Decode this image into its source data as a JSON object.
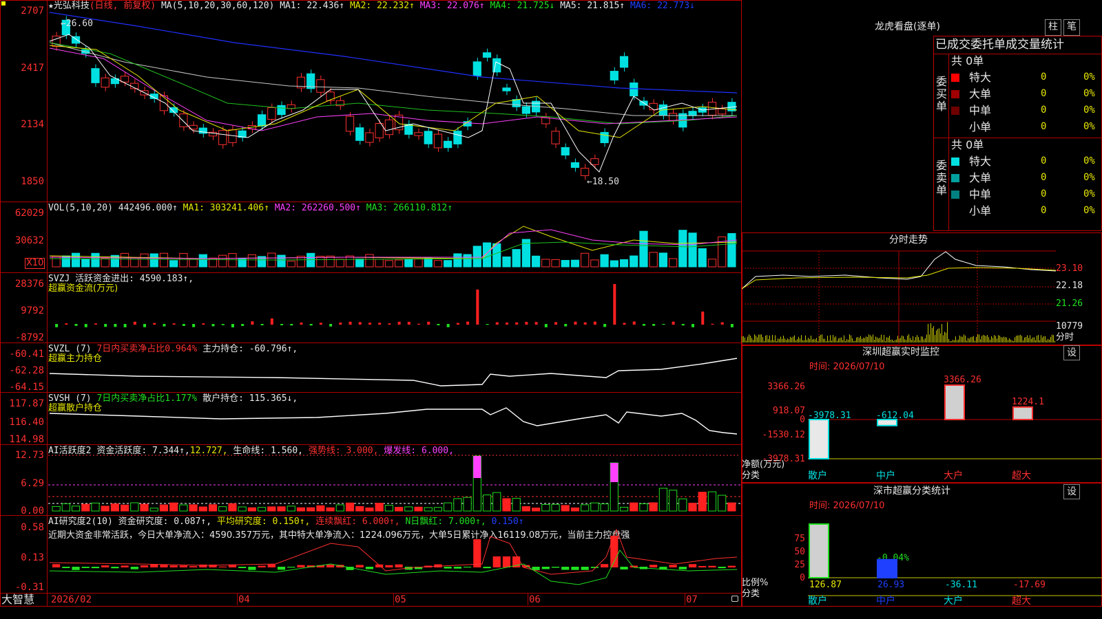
{
  "main_header": {
    "star": "★",
    "stock_name": "光弘科技",
    "period": "(日线, 前复权)",
    "ma_label": "MA(5,10,20,30,60,120)",
    "ma1": "MA1: 22.436↑",
    "ma2": "MA2: 22.232↑",
    "ma3": "MA3: 22.076↑",
    "ma4": "MA4: 21.725↓",
    "ma5": "MA5: 21.815↑",
    "ma6": "MA6: 22.773↓"
  },
  "price_axis": [
    "2707",
    "2417",
    "2134",
    "1850"
  ],
  "price_annotations": {
    "high": "←26.60",
    "low": "←18.50"
  },
  "vol": {
    "label": "VOL(5,10,20)",
    "value": "442496.000↑",
    "ma1": "MA1: 303241.406↑",
    "ma2": "MA2: 262260.500↑",
    "ma3": "MA3: 266110.812↑",
    "axis": [
      "62029",
      "30632"
    ],
    "unit": "X10"
  },
  "svzj": {
    "label": "SVZJ",
    "active_label": "活跃资金进出: 4590.183↑,",
    "subtitle": "超赢资金流(万元)",
    "axis": [
      "28376",
      "9792",
      "-8792"
    ]
  },
  "svzl": {
    "label": "SVZL (7)",
    "ratio": "7日内买卖净占比0.964%",
    "holding": "主力持仓: -60.796↑,",
    "subtitle": "超赢主力持仓",
    "axis": [
      "-60.41",
      "-62.28",
      "-64.15"
    ]
  },
  "svsh": {
    "label": "SVSH (7)",
    "ratio": "7日内买卖净占比1.177%",
    "holding": "散户持仓: 115.365↓,",
    "subtitle": "超赢散户持仓",
    "axis": [
      "117.87",
      "116.40",
      "114.98"
    ]
  },
  "ai_active": {
    "label": "AI活跃度2",
    "activity": "资金活跃度: 7.344↑,",
    "v2": "12.727,",
    "life": "生命线: 1.560,",
    "strong": "强势线: 3.000,",
    "burst": "爆发线: 6.000,",
    "axis": [
      "12.73",
      "6.29",
      "0.00"
    ]
  },
  "ai_research": {
    "label": "AI研究度2(10)",
    "research": "资金研究度: 0.087↑,",
    "avg": "平均研究度: 0.150↑,",
    "streak": "连续飘红: 6.000↑,",
    "nday": "N日飘红: 7.000↑,",
    "last": "0.150↑",
    "comment": "近期大资金非常活跃，今日大单净流入：4590.357万元，其中特大单净流入：1224.096万元，大单5日累计净入16119.08万元，当前主力控盘强",
    "axis": [
      "0.58",
      "0.13",
      "-0.31"
    ]
  },
  "date_axis": [
    "2026/02",
    "04",
    "05",
    "06",
    "07"
  ],
  "brand": "大智慧",
  "dragon": {
    "title": "龙虎看盘(逐单)",
    "tab_bar": "柱",
    "tab_pen": "笔",
    "subtitle": "已成交委托单成交量统计",
    "buy": {
      "side": "委买单",
      "total": "共 0单",
      "rows": [
        {
          "label": "特大",
          "value": "0",
          "pct": "0%",
          "color": "#ff0000"
        },
        {
          "label": "大单",
          "value": "0",
          "pct": "0%",
          "color": "#a00000"
        },
        {
          "label": "中单",
          "value": "0",
          "pct": "0%",
          "color": "#700000"
        },
        {
          "label": "小单",
          "value": "0",
          "pct": "0%",
          "color": "#000000"
        }
      ]
    },
    "sell": {
      "side": "委卖单",
      "total": "共 0单",
      "rows": [
        {
          "label": "特大",
          "value": "0",
          "pct": "0%",
          "color": "#00e0e0"
        },
        {
          "label": "大单",
          "value": "0",
          "pct": "0%",
          "color": "#00a0a0"
        },
        {
          "label": "中单",
          "value": "0",
          "pct": "0%",
          "color": "#008080"
        },
        {
          "label": "小单",
          "value": "0",
          "pct": "0%",
          "color": "#000000"
        }
      ]
    }
  },
  "intraday": {
    "title": "分时走势",
    "axis": [
      "23.10",
      "22.18",
      "21.26"
    ],
    "vol_axis": "10779",
    "vol_unit": "分时"
  },
  "sz_monitor": {
    "title": "深圳超赢实时监控",
    "settings": "设",
    "time": "时间: 2026/07/10",
    "axis": [
      "3366.26",
      "918.07",
      "0",
      "-1530.12",
      "-3978.31"
    ],
    "y_caption": "净额(万元)",
    "x_caption": "分类",
    "categories": [
      "散户",
      "中户",
      "大户",
      "超大"
    ],
    "values": [
      -3978.31,
      -612.04,
      3366.26,
      1224.1
    ],
    "labels": [
      "-3978.31",
      "-612.04",
      "3366.26",
      "1224.1"
    ]
  },
  "sz_class": {
    "title": "深市超赢分类统计",
    "settings": "设",
    "time": "时间: 2026/07/10",
    "axis": [
      "75",
      "50",
      "25",
      "0"
    ],
    "y_caption": "比例%",
    "x_caption": "分类",
    "categories": [
      "散户",
      "中户",
      "大户",
      "超大"
    ],
    "values": [
      126.87,
      26.93,
      -36.11,
      -17.69
    ],
    "labels": [
      "126.87",
      "26.93",
      "-36.11",
      "-17.69"
    ],
    "annotation": "-0.04%"
  }
}
